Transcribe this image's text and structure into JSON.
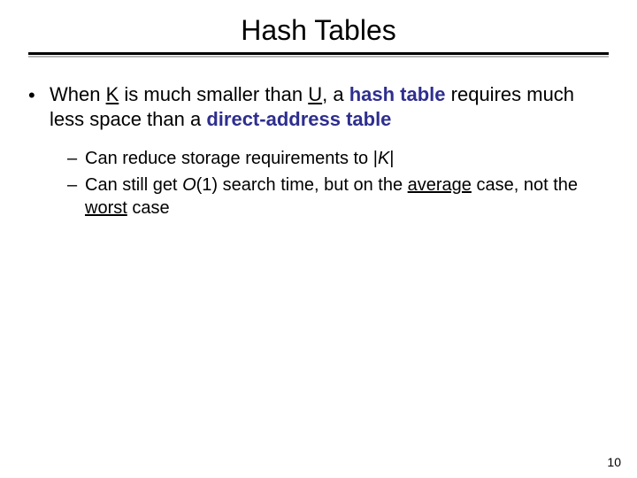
{
  "title": "Hash Tables",
  "bullet": {
    "seg1": "When ",
    "k": "K",
    "seg2": " is much smaller than ",
    "u": "U",
    "seg3": ", a ",
    "bold1": "hash table",
    "seg4": " requires much less space than a ",
    "bold2": "direct-address table"
  },
  "sub": {
    "item1": {
      "seg1": "Can reduce storage requirements to |",
      "k": "K",
      "seg2": "|"
    },
    "item2": {
      "seg1": "Can still get ",
      "o": "O",
      "seg2": "(1) search time, but on the ",
      "avg": "average",
      "seg3": " case, not the ",
      "worst": "worst",
      "seg4": " case"
    }
  },
  "pageNumber": "10"
}
